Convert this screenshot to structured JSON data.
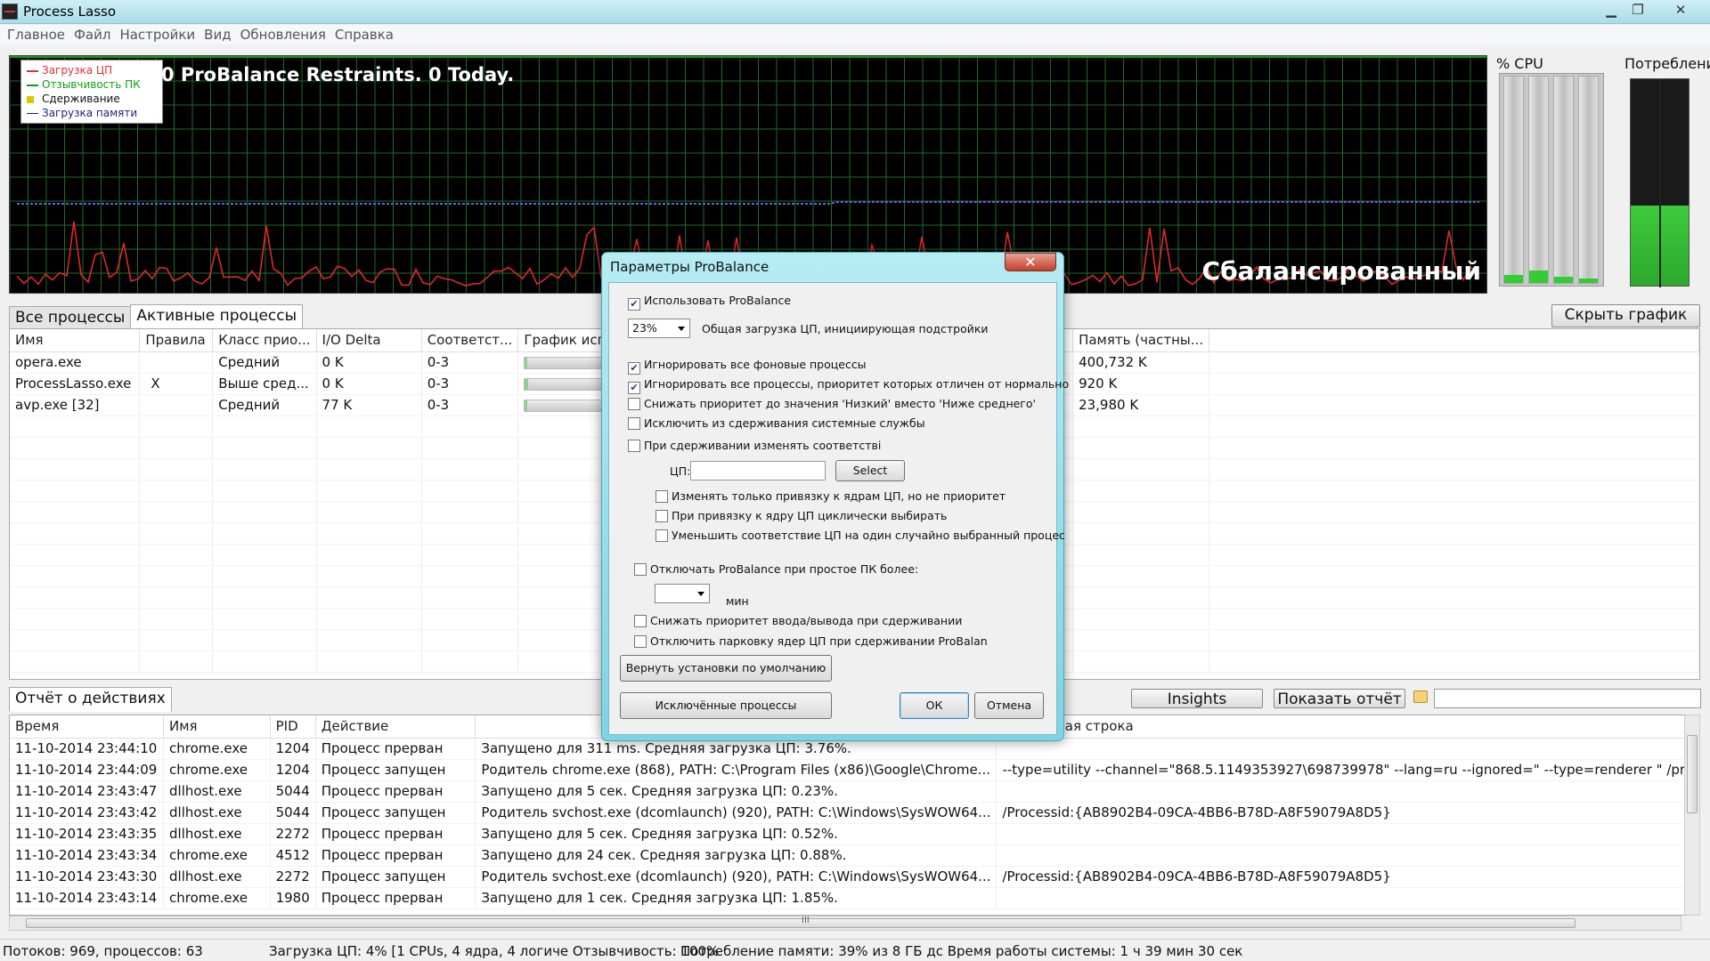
{
  "window": {
    "title": "Process Lasso",
    "minimize": "▁",
    "maximize": "❐",
    "close": "✕"
  },
  "menu": [
    "Главное",
    "Файл",
    "Настройки",
    "Вид",
    "Обновления",
    "Справка"
  ],
  "graph": {
    "legend": [
      {
        "label": "Загрузка ЦП",
        "color": "#e03030"
      },
      {
        "label": "Отзывчивость ПК",
        "color": "#10a010"
      },
      {
        "label": "Сдерживание",
        "color": "#d8c800"
      },
      {
        "label": "Загрузка памяти",
        "color": "#202080"
      }
    ],
    "restraints": "0 ProBalance Restraints. 0 Today.",
    "mode": "Сбалансированный"
  },
  "cpu_panel": {
    "title": "% CPU",
    "cores": [
      0.04,
      0.06,
      0.03,
      0.02
    ]
  },
  "mem_panel": {
    "title": "Потребление",
    "usage": 0.39
  },
  "tabs": {
    "all": "Все процессы",
    "active": "Активные процессы",
    "hide_graph": "Скрыть график"
  },
  "process_table": {
    "columns": [
      "Имя",
      "Правила",
      "Класс прио...",
      "I/O Delta",
      "Соответст...",
      "График использ...",
      "",
      "Память (частны..."
    ],
    "rows": [
      {
        "name": "opera.exe",
        "rules": "",
        "priority": "Средний",
        "io": "0 K",
        "affinity": "0-3",
        "usage": 0.02,
        "memory": "400,732 K"
      },
      {
        "name": "ProcessLasso.exe",
        "rules": "X",
        "priority": "Выше сред...",
        "io": "0 K",
        "affinity": "0-3",
        "usage": 0.03,
        "memory": "920 K"
      },
      {
        "name": "avp.exe [32]",
        "rules": "",
        "priority": "Средний",
        "io": "77 K",
        "affinity": "0-3",
        "usage": 0.02,
        "memory": "23,980 K"
      }
    ]
  },
  "log": {
    "tab": "Отчёт о действиях",
    "insights": "Insights",
    "show_report": "Показать отчёт",
    "columns": [
      "Время",
      "Имя",
      "PID",
      "Действие",
      "",
      "Командная строка"
    ],
    "rows": [
      [
        "11-10-2014 23:44:10",
        "chrome.exe",
        "1204",
        "Процесс прерван",
        "Запущено для 311 ms. Средняя загрузка ЦП: 3.76%.",
        ""
      ],
      [
        "11-10-2014 23:44:09",
        "chrome.exe",
        "1204",
        "Процесс запущен",
        "Родитель chrome.exe (868), PATH: C:\\Program Files (x86)\\Google\\Chrome...",
        "--type=utility --channel=\"868.5.1149353927\\698739978\" --lang=ru --ignored=\" --type=renderer \" /pre"
      ],
      [
        "11-10-2014 23:43:47",
        "dllhost.exe",
        "5044",
        "Процесс прерван",
        "Запущено для 5 сек. Средняя загрузка ЦП: 0.23%.",
        ""
      ],
      [
        "11-10-2014 23:43:42",
        "dllhost.exe",
        "5044",
        "Процесс запущен",
        "Родитель svchost.exe (dcomlaunch) (920), PATH: C:\\Windows\\SysWOW64...",
        "/Processid:{AB8902B4-09CA-4BB6-B78D-A8F59079A8D5}"
      ],
      [
        "11-10-2014 23:43:35",
        "dllhost.exe",
        "2272",
        "Процесс прерван",
        "Запущено для 5 сек. Средняя загрузка ЦП: 0.52%.",
        ""
      ],
      [
        "11-10-2014 23:43:34",
        "chrome.exe",
        "4512",
        "Процесс прерван",
        "Запущено для 24 сек. Средняя загрузка ЦП: 0.88%.",
        ""
      ],
      [
        "11-10-2014 23:43:30",
        "dllhost.exe",
        "2272",
        "Процесс запущен",
        "Родитель svchost.exe (dcomlaunch) (920), PATH: C:\\Windows\\SysWOW64...",
        "/Processid:{AB8902B4-09CA-4BB6-B78D-A8F59079A8D5}"
      ],
      [
        "11-10-2014 23:43:14",
        "chrome.exe",
        "1980",
        "Процесс прерван",
        "Запущено для 1 сек. Средняя загрузка ЦП: 1.85%.",
        ""
      ]
    ],
    "scroll_label": "III"
  },
  "status": {
    "threads": "Потоков: 969, процессов: 63",
    "cpu": "Загрузка ЦП: 4% [1 CPUs, 4 ядра, 4 логиче Отзывчивость: 100%",
    "memory": "Потребление памяти: 39% из 8 ГБ дс Время работы системы: 1 ч 39 мин 30 сек"
  },
  "dialog": {
    "title": "Параметры ProBalance",
    "close": "✕",
    "use_probalance": "Использовать ProBalance",
    "threshold_value": "23%",
    "threshold_label": "Общая загрузка ЦП, инициирующая подстройки",
    "ignore_background": "Игнорировать все фоновые процессы",
    "ignore_nonnormal": "Игнорировать все процессы, приоритет которых отличен от нормально",
    "lower_to_low": "Снижать приоритет до значения 'Низкий' вместо 'Ниже среднего'",
    "exclude_services": "Исключить из сдерживания системные службы",
    "change_affinity": "При сдерживании изменять соответстві",
    "cpu_label": "ЦП:",
    "select": "Select",
    "affinity_only": "Изменять только привязку к ядрам ЦП, но не приоритет",
    "cycle_cores": "При привязку к ядру ЦП циклически выбирать",
    "reduce_random": "Уменьшить соответствие ЦП на один случайно выбранный процес",
    "disable_idle": "Отключать ProBalance при простое ПК более:",
    "minutes": "мин",
    "lower_io": "Снижать приоритет ввода/вывода при сдерживании",
    "disable_parking": "Отключить парковку ядер ЦП при сдерживании ProBalan",
    "restore_defaults": "Вернуть установки по умолчанию",
    "excluded_processes": "Исключённые процессы",
    "ok": "ОК",
    "cancel": "Отмена",
    "checked": "✔"
  }
}
